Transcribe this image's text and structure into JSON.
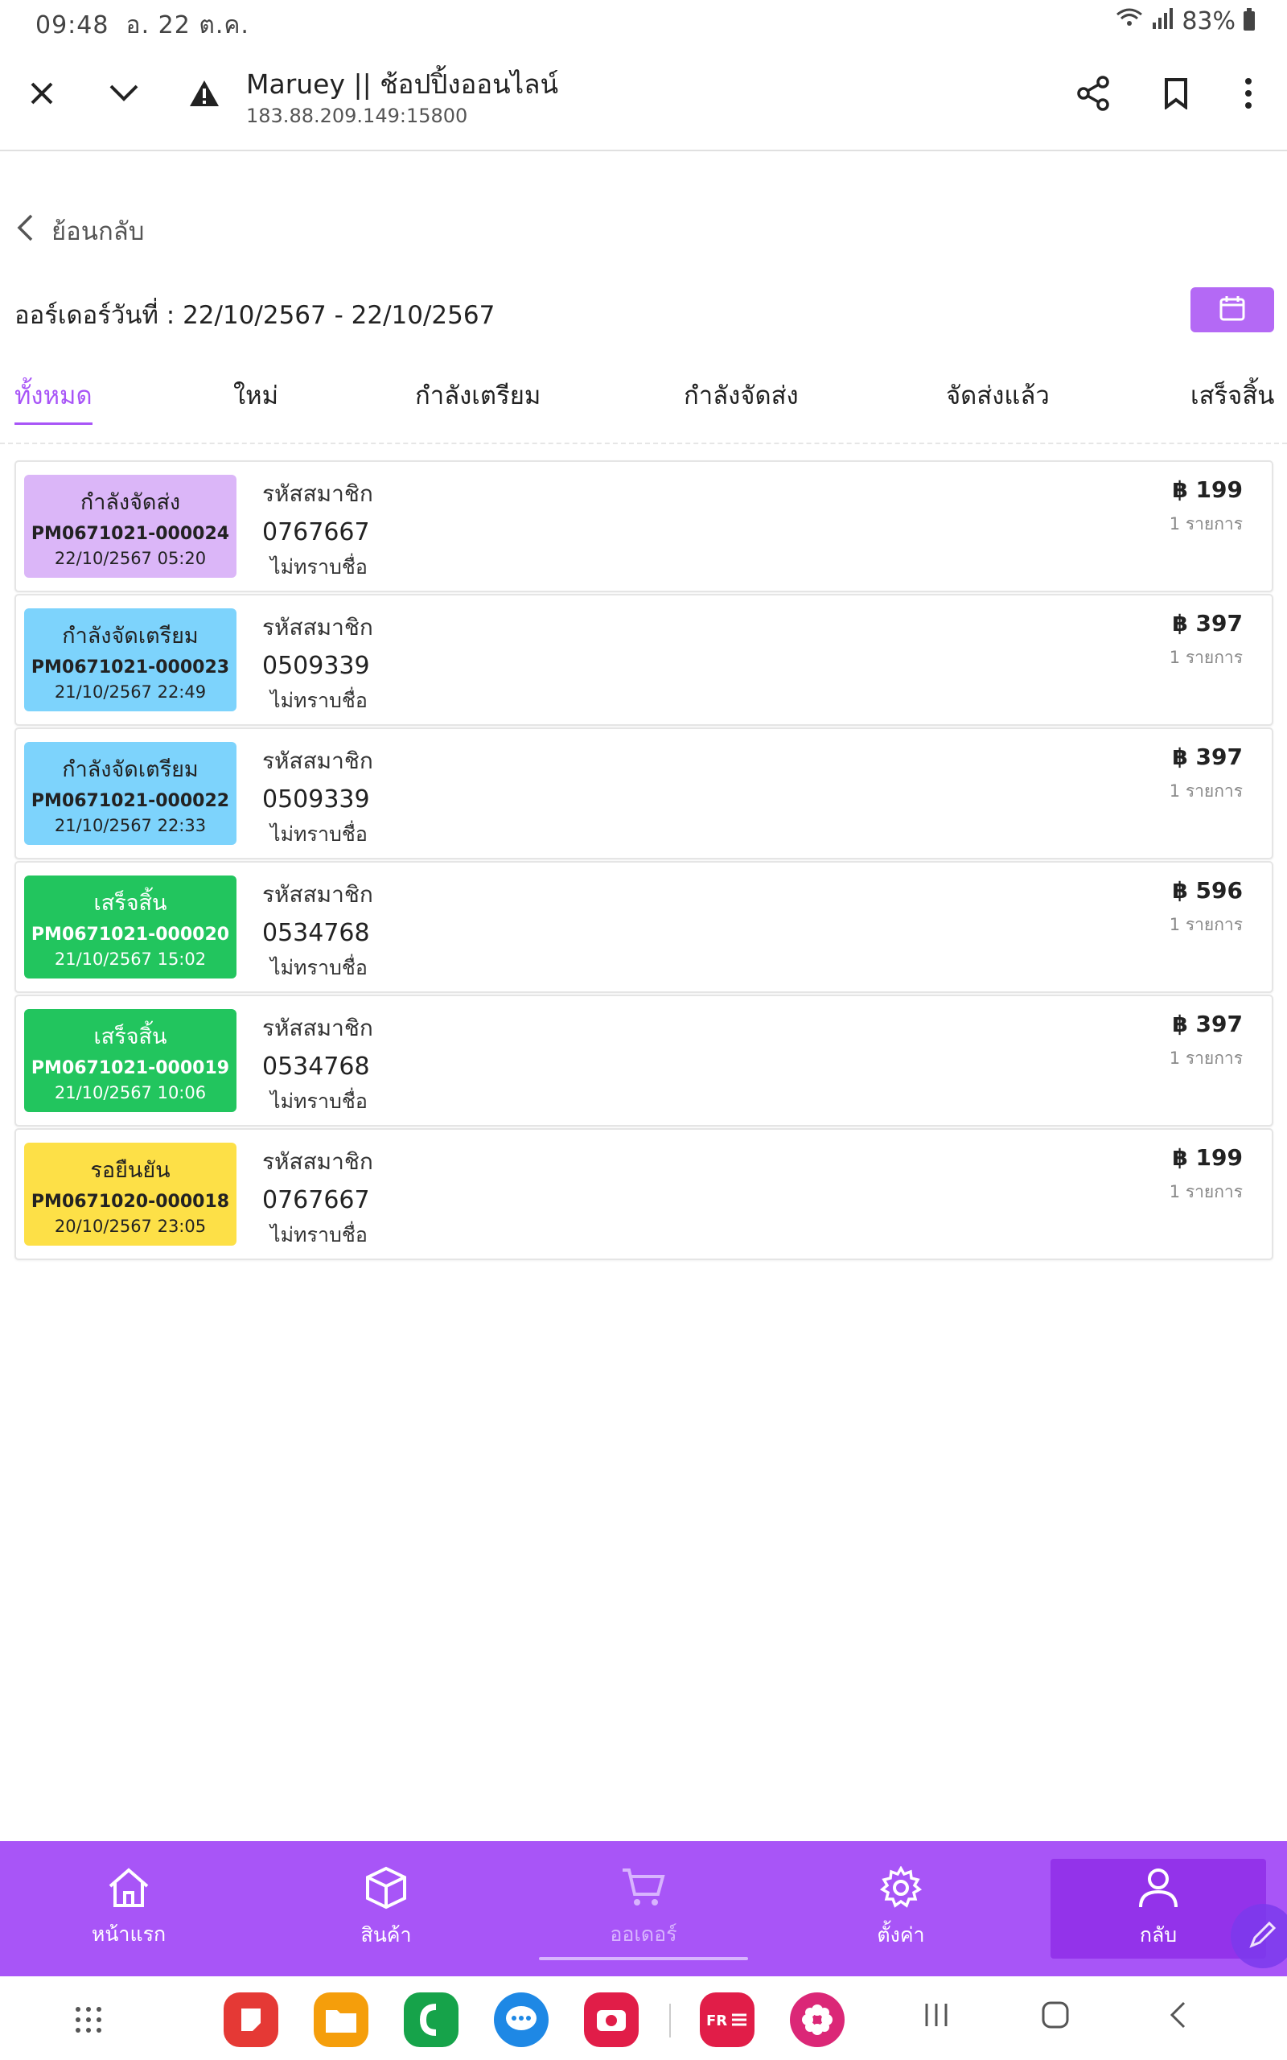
{
  "status_bar": {
    "time": "09:48",
    "date": "อ. 22 ต.ค.",
    "battery": "83%"
  },
  "browser": {
    "title": "Maruey || ช้อปปิ้งออนไลน์",
    "url": "183.88.209.149:15800"
  },
  "back_label": "ย้อนกลับ",
  "order_date": "ออร์เดอร์วันที่ : 22/10/2567 - 22/10/2567",
  "tabs": [
    {
      "label": "ทั้งหมด"
    },
    {
      "label": "ใหม่"
    },
    {
      "label": "กำลังเตรียม"
    },
    {
      "label": "กำลังจัดส่ง"
    },
    {
      "label": "จัดส่งแล้ว"
    },
    {
      "label": "เสร็จสิ้น"
    }
  ],
  "orders": [
    {
      "status": "กำลังจัดส่ง",
      "status_color": "#dbb6f8",
      "id": "PM0671021-000024",
      "datetime": "22/10/2567 05:20",
      "member_label": "รหัสสมาชิก",
      "member_code": "0767667",
      "name": "ไม่ทราบชื่อ",
      "amount": "฿ 199",
      "items": "1 รายการ"
    },
    {
      "status": "กำลังจัดเตรียม",
      "status_color": "#7dd3fc",
      "id": "PM0671021-000023",
      "datetime": "21/10/2567 22:49",
      "member_label": "รหัสสมาชิก",
      "member_code": "0509339",
      "name": "ไม่ทราบชื่อ",
      "amount": "฿ 397",
      "items": "1 รายการ"
    },
    {
      "status": "กำลังจัดเตรียม",
      "status_color": "#7dd3fc",
      "id": "PM0671021-000022",
      "datetime": "21/10/2567 22:33",
      "member_label": "รหัสสมาชิก",
      "member_code": "0509339",
      "name": "ไม่ทราบชื่อ",
      "amount": "฿ 397",
      "items": "1 รายการ"
    },
    {
      "status": "เสร็จสิ้น",
      "status_color": "#22c55e",
      "id": "PM0671021-000020",
      "datetime": "21/10/2567 15:02",
      "member_label": "รหัสสมาชิก",
      "member_code": "0534768",
      "name": "ไม่ทราบชื่อ",
      "amount": "฿ 596",
      "items": "1 รายการ"
    },
    {
      "status": "เสร็จสิ้น",
      "status_color": "#22c55e",
      "id": "PM0671021-000019",
      "datetime": "21/10/2567 10:06",
      "member_label": "รหัสสมาชิก",
      "member_code": "0534768",
      "name": "ไม่ทราบชื่อ",
      "amount": "฿ 397",
      "items": "1 รายการ"
    },
    {
      "status": "รอยืนยัน",
      "status_color": "#fde047",
      "id": "PM0671020-000018",
      "datetime": "20/10/2567 23:05",
      "member_label": "รหัสสมาชิก",
      "member_code": "0767667",
      "name": "ไม่ทราบชื่อ",
      "amount": "฿ 199",
      "items": "1 รายการ"
    }
  ],
  "bottom_nav": [
    {
      "label": "หน้าแรก",
      "icon": "home-icon"
    },
    {
      "label": "สินค้า",
      "icon": "box-icon"
    },
    {
      "label": "ออเดอร์",
      "icon": "cart-icon"
    },
    {
      "label": "ตั้งค่า",
      "icon": "gear-icon"
    },
    {
      "label": "กลับ",
      "icon": "user-icon"
    }
  ],
  "colors": {
    "accent": "#a855f7",
    "calendar_button": "#b469f5"
  }
}
